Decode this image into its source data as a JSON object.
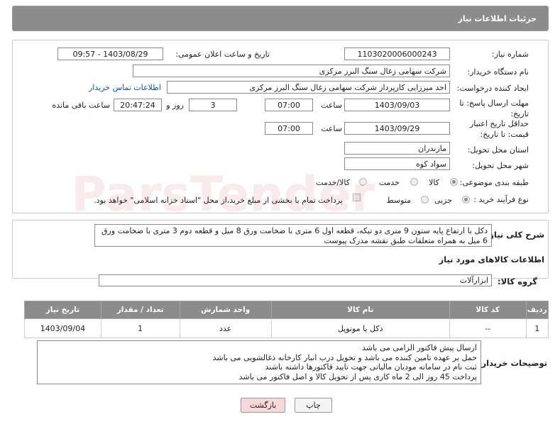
{
  "header": {
    "title": "جزئیات اطلاعات نیاز"
  },
  "fields": {
    "need_number_label": "شماره نیاز:",
    "need_number": "1103020006000243",
    "announce_label": "تاریخ و ساعت اعلان عمومی:",
    "announce_value": "1403/08/29 - 09:57",
    "buyer_org_label": "نام دستگاه خریدار:",
    "buyer_org": "شرکت سهامی زغال سنگ البرز مرکزی",
    "creator_label": "ایجاد کننده درخواست:",
    "creator": "احد میرزایی کارپرداز شرکت سهامی زغال سنگ البرز مرکزی",
    "contact_link": "اطلاعات تماس خریدار",
    "deadline_label": "مهلت ارسال پاسخ: تا تاریخ:",
    "deadline_date": "1403/09/03",
    "time_label": "ساعت",
    "deadline_time": "07:00",
    "days_value": "3",
    "days_label": "روز و",
    "remaining_time": "20:47:24",
    "remaining_label": "ساعت باقی مانده",
    "validity_label": "حداقل تاریخ اعتبار قیمت: تا تاریخ:",
    "validity_date": "1403/09/29",
    "validity_time": "07:00",
    "province_label": "استان محل تحویل:",
    "province": "مازندران",
    "city_label": "شهر محل تحویل:",
    "city": "سواد کوه",
    "category_label": "طبقه بندی موضوعی:",
    "category_goods": "کالا",
    "category_service": "خدمت",
    "category_goods_service": "کالا/خدمت",
    "process_label": "نوع فرآیند خرید :",
    "process_partial": "جزیی",
    "process_medium": "متوسط",
    "process_note": "پرداخت تمام یا بخشی از مبلغ خرید،از محل \"اسناد خزانه اسلامی\" خواهد بود."
  },
  "description": {
    "label": "شرح کلی نیاز:",
    "text": "دکل با ارتفاع پایه ستون 9 متری دو تیکه، قطعه اول 6 متری با ضخامت ورق 8 میل و قطعه دوم 3 متری با ضخامت ورق 6 میل به همراه متعلقات طبق نقشه مدرک پیوست"
  },
  "goods_info": {
    "title": "اطلاعات کالاهای مورد نیاز",
    "group_label": "گروه کالا:",
    "group_value": "ابزارآلات"
  },
  "table": {
    "headers": [
      "ردیف",
      "کد کالا",
      "نام کالا",
      "واحد شمارش",
      "تعداد / مقدار",
      "تاریخ نیاز"
    ],
    "rows": [
      {
        "row": "1",
        "code": "--",
        "name": "دکل یا مونوپل",
        "unit": "عدد",
        "qty": "1",
        "date": "1403/09/04"
      }
    ]
  },
  "buyer_notes": {
    "label": "توضیحات خریدار:",
    "lines": [
      "ارسال پیش فاکتور الزامی می باشد",
      "حمل بر عهده تامین کننده می باشد و تحویل درب انبار کارخانه ذغالشویی می باشد",
      "ثبت نام در سامانه مودیان مالیاتی جهت تایید فاکتورها داشته باشند",
      "پرداخت 45 روز الی 2 ماه کاری پس از تحویل کالا و اصل فاکتور می باشد"
    ]
  },
  "buttons": {
    "print": "چاپ",
    "back": "بازگشت"
  },
  "colors": {
    "header_bg": "#8c8c8c",
    "link": "#1a4fa8",
    "back_button_bg": "#f7d9d9"
  }
}
